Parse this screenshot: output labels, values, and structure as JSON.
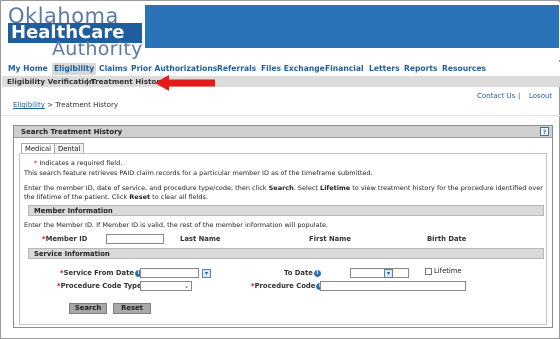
{
  "header": {
    "logo_top": "Oklahoma",
    "logo_middle": "HealthCare",
    "logo_bottom": "Authority"
  },
  "nav": {
    "items": [
      "My Home",
      "Eligibility",
      "Claims",
      "Prior Authorizations",
      "Referrals",
      "Files Exchange",
      "Financial",
      "Letters",
      "Reports",
      "Resources"
    ],
    "active": "Eligibility"
  },
  "subnav": {
    "items": [
      "Eligibility Verification",
      "|",
      "Treatment History"
    ]
  },
  "top_links": {
    "contact": "Contact Us",
    "separator": "|",
    "logout": "Losout"
  },
  "breadcrumb": {
    "parent": "Eligibility",
    "separator": ">",
    "current": "Treatment History"
  },
  "panel": {
    "title": "Search Treatment History",
    "help": "?",
    "tabs": [
      "Medical",
      "Dental"
    ],
    "active_tab": "Medical"
  },
  "intro": {
    "required_star": "*",
    "required_note": " Indicates a required field.",
    "line1": "This search feature retrieves PAID claim records for a particular member ID as of the timeframe submitted.",
    "line2_a": "Enter the member ID, date of service, and procedure type/code, then click ",
    "line2_search": "Search",
    "line2_b": ".  Select ",
    "line2_lifetime": "Lifetime",
    "line2_c": " to view treatment history for the procedure identified over",
    "line3_a": "the lifetime of the patient.  Click ",
    "line3_reset": "Reset",
    "line3_b": " to clear all fields."
  },
  "member_info": {
    "title": "Member Information",
    "note": "Enter the Member ID. If Member ID is valid, the rest of the member information will populate.",
    "member_id_label": "Member ID",
    "member_id_value": "",
    "last_name_label": "Last Name",
    "first_name_label": "First Name",
    "birth_date_label": "Birth Date"
  },
  "service_info": {
    "title": "Service Information",
    "from_label": "Service From Date",
    "from_value": "",
    "to_label": "To Date",
    "to_value": "",
    "lifetime_label": "Lifetime",
    "lifetime_checked": false,
    "code_type_label": "Procedure Code Type",
    "code_type_value": "",
    "code_label": "Procedure Code",
    "code_value": "",
    "required_star": "*",
    "info_glyph": "i",
    "calendar_glyph": "▾",
    "chevron_glyph": "⌄"
  },
  "buttons": {
    "search": "Search",
    "reset": "Reset"
  },
  "colors": {
    "brand_blue": "#1e5e9f",
    "header_band": "#2a73b8",
    "arrow_red": "#e41b1b",
    "required_red": "#cc0000"
  }
}
